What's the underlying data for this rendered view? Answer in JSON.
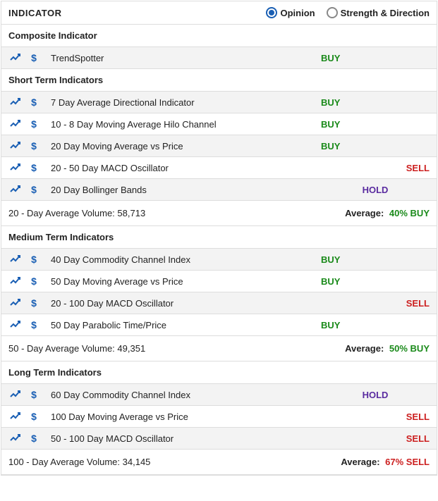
{
  "header": {
    "title": "INDICATOR",
    "radios": {
      "opinion": "Opinion",
      "strength": "Strength & Direction",
      "selected": "opinion"
    }
  },
  "groups": [
    {
      "title": "Composite Indicator",
      "rows": [
        {
          "name": "TrendSpotter",
          "signal": "BUY",
          "kind": "buy",
          "alt": true
        }
      ],
      "summary": null
    },
    {
      "title": "Short Term Indicators",
      "rows": [
        {
          "name": "7 Day Average Directional Indicator",
          "signal": "BUY",
          "kind": "buy",
          "alt": true
        },
        {
          "name": "10 - 8 Day Moving Average Hilo Channel",
          "signal": "BUY",
          "kind": "buy",
          "alt": false
        },
        {
          "name": "20 Day Moving Average vs Price",
          "signal": "BUY",
          "kind": "buy",
          "alt": true
        },
        {
          "name": "20 - 50 Day MACD Oscillator",
          "signal": "SELL",
          "kind": "sell",
          "alt": false
        },
        {
          "name": "20 Day Bollinger Bands",
          "signal": "HOLD",
          "kind": "hold",
          "alt": true
        }
      ],
      "summary": {
        "volume_label": "20 - Day Average Volume: 58,713",
        "avg_label": "Average:",
        "avg_value": "40% BUY",
        "avg_kind": "buy"
      }
    },
    {
      "title": "Medium Term Indicators",
      "rows": [
        {
          "name": "40 Day Commodity Channel Index",
          "signal": "BUY",
          "kind": "buy",
          "alt": true
        },
        {
          "name": "50 Day Moving Average vs Price",
          "signal": "BUY",
          "kind": "buy",
          "alt": false
        },
        {
          "name": "20 - 100 Day MACD Oscillator",
          "signal": "SELL",
          "kind": "sell",
          "alt": true
        },
        {
          "name": "50 Day Parabolic Time/Price",
          "signal": "BUY",
          "kind": "buy",
          "alt": false
        }
      ],
      "summary": {
        "volume_label": "50 - Day Average Volume: 49,351",
        "avg_label": "Average:",
        "avg_value": "50% BUY",
        "avg_kind": "buy"
      }
    },
    {
      "title": "Long Term Indicators",
      "rows": [
        {
          "name": "60 Day Commodity Channel Index",
          "signal": "HOLD",
          "kind": "hold",
          "alt": true
        },
        {
          "name": "100 Day Moving Average vs Price",
          "signal": "SELL",
          "kind": "sell",
          "alt": false
        },
        {
          "name": "50 - 100 Day MACD Oscillator",
          "signal": "SELL",
          "kind": "sell",
          "alt": true
        }
      ],
      "summary": {
        "volume_label": "100 - Day Average Volume: 34,145",
        "avg_label": "Average:",
        "avg_value": "67% SELL",
        "avg_kind": "sell"
      }
    }
  ]
}
